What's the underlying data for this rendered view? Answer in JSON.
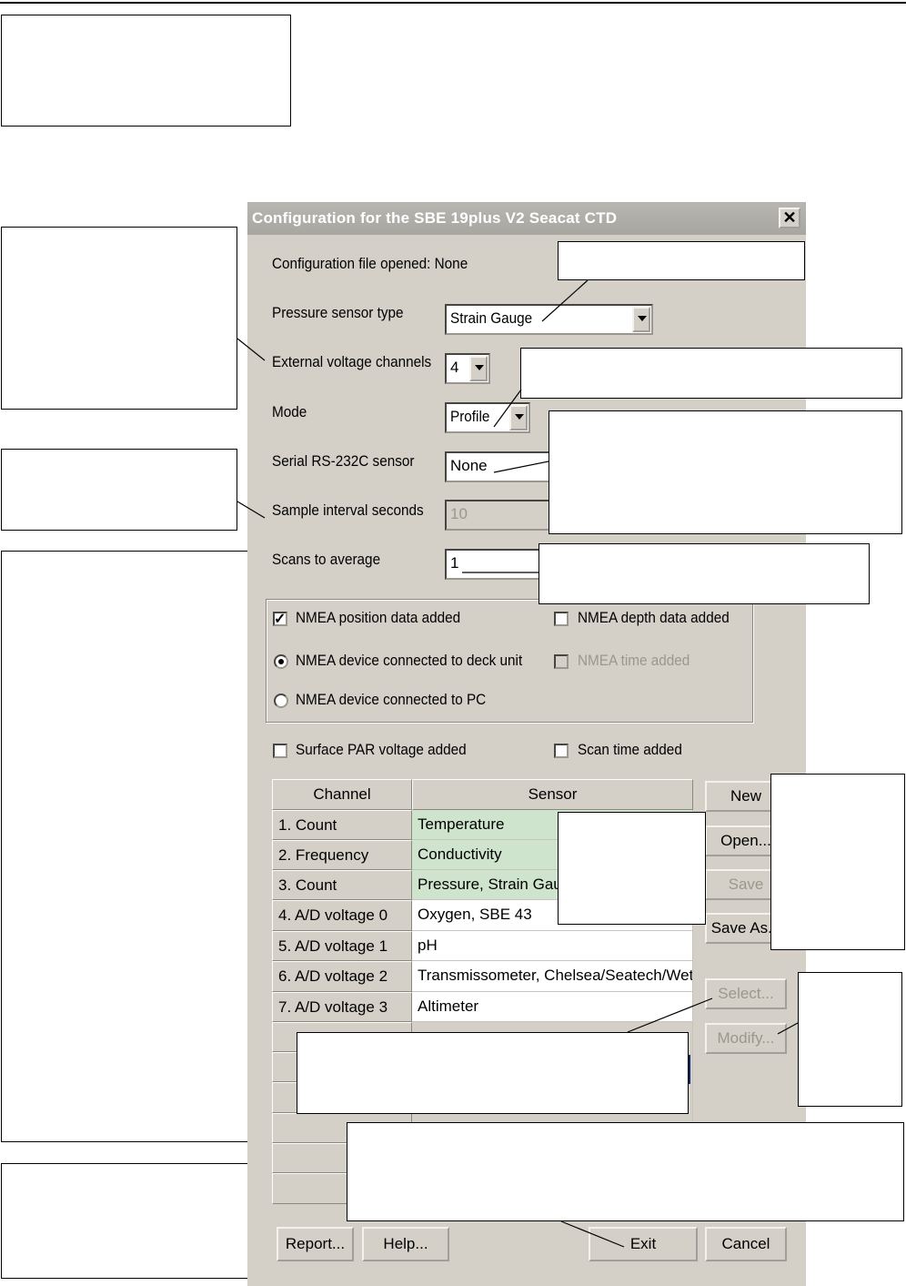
{
  "dialog": {
    "title": "Configuration for the SBE 19plus V2 Seacat CTD",
    "close_glyph": "✕",
    "config_file_label": "Configuration file opened: None",
    "pressure_label": "Pressure sensor type",
    "pressure_value": "Strain Gauge",
    "ext_voltage_label": "External voltage channels",
    "ext_voltage_value": "4",
    "mode_label": "Mode",
    "mode_value": "Profile",
    "serial_label": "Serial RS-232C sensor",
    "serial_value": "None",
    "sample_label": "Sample interval seconds",
    "sample_value": "10",
    "scans_label": "Scans to average",
    "scans_value": "1",
    "nmea_position_label": "NMEA position data added",
    "nmea_position_checked": true,
    "nmea_depth_label": "NMEA depth data added",
    "nmea_deck_label": "NMEA device connected to deck unit",
    "nmea_time_label": "NMEA time added",
    "nmea_pc_label": "NMEA device connected to PC",
    "surface_par_label": "Surface PAR voltage added",
    "scan_time_label": "Scan time added",
    "table": {
      "headers": [
        "Channel",
        "Sensor"
      ],
      "rows": [
        {
          "channel": "1. Count",
          "sensor": "Temperature"
        },
        {
          "channel": "2. Frequency",
          "sensor": "Conductivity"
        },
        {
          "channel": "3. Count",
          "sensor": "Pressure, Strain Gauge"
        },
        {
          "channel": "4. A/D voltage 0",
          "sensor": "Oxygen, SBE 43"
        },
        {
          "channel": "5. A/D voltage 1",
          "sensor": "pH"
        },
        {
          "channel": "6. A/D voltage 2",
          "sensor": "Transmissometer, Chelsea/Seatech/Wetlab"
        },
        {
          "channel": "7. A/D voltage 3",
          "sensor": "Altimeter"
        }
      ]
    },
    "buttons": {
      "new": "New",
      "open": "Open...",
      "save": "Save",
      "save_as": "Save As...",
      "select": "Select...",
      "modify": "Modify...",
      "report": "Report...",
      "help": "Help...",
      "exit": "Exit",
      "cancel": "Cancel"
    }
  },
  "colors": {
    "dialog_face": "#d4d0c8",
    "title_bar": "#a8a6a0",
    "green_row": "#cfe4cd",
    "disabled_text": "#9b978f"
  }
}
